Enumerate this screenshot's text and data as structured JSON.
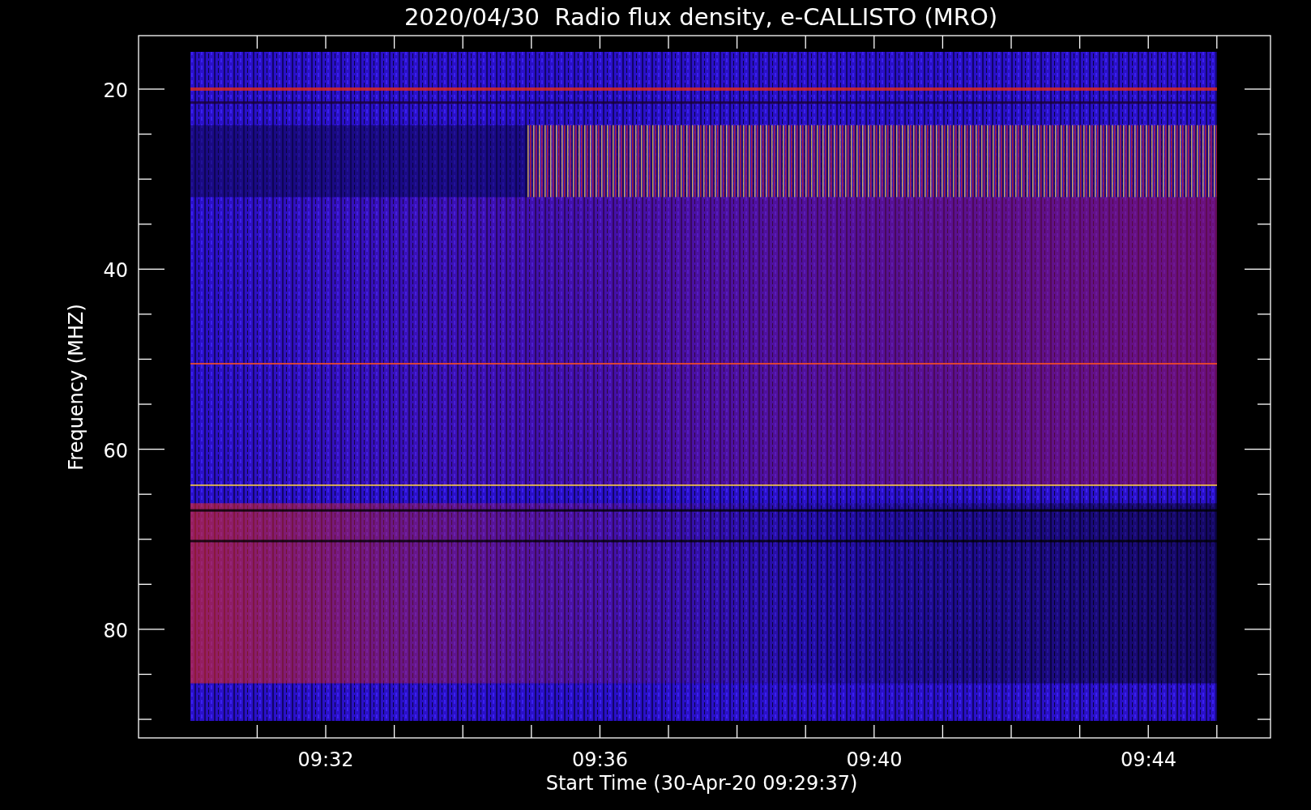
{
  "title": "2020/04/30  Radio flux density, e-CALLISTO (MRO)",
  "y_axis": {
    "label": "Frequency (MHZ)",
    "ticks": [
      "20",
      "40",
      "60",
      "80"
    ]
  },
  "x_axis": {
    "label": "Start Time (30-Apr-20 09:29:37)",
    "ticks": [
      "09:32",
      "09:36",
      "09:40",
      "09:44"
    ]
  }
}
